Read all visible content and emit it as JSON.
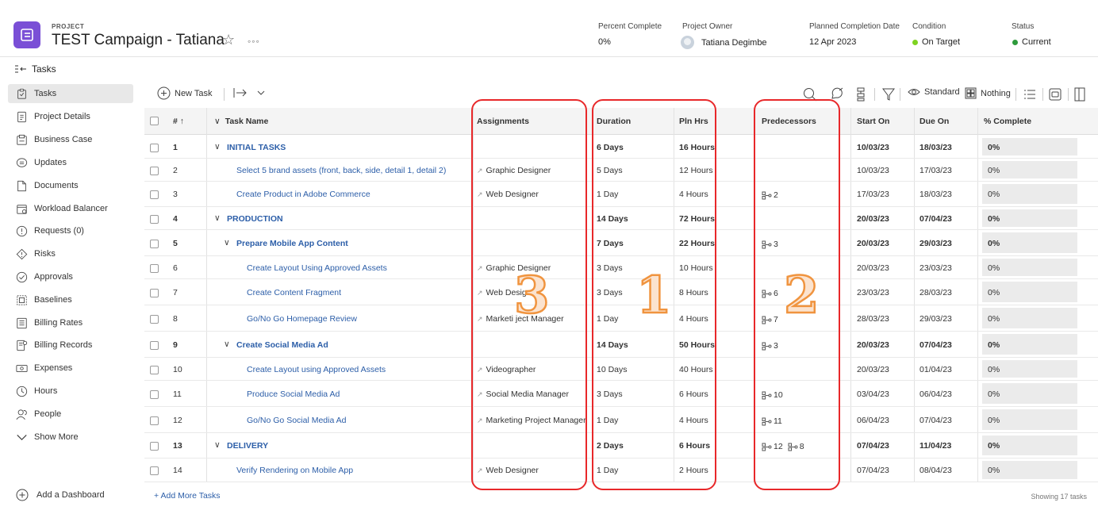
{
  "header": {
    "project_label": "PROJECT",
    "title": "TEST Campaign - Tatiana",
    "more_label": "◦◦◦",
    "stats": [
      {
        "label": "Percent Complete",
        "value": "0%"
      },
      {
        "label": "Project Owner",
        "value": "Tatiana Degimbe"
      },
      {
        "label": "Planned Completion Date",
        "value": "12 Apr 2023"
      },
      {
        "label": "Condition",
        "value": "On Target",
        "color": "#7ed321"
      },
      {
        "label": "Status",
        "value": "Current",
        "color": "#2e9b3c"
      }
    ]
  },
  "breadcrumb": {
    "label": "Tasks"
  },
  "sidebar": {
    "items": [
      {
        "label": "Tasks",
        "icon": "tasks-icon"
      },
      {
        "label": "Project Details",
        "icon": "details-icon"
      },
      {
        "label": "Business Case",
        "icon": "business-case-icon"
      },
      {
        "label": "Updates",
        "icon": "updates-icon"
      },
      {
        "label": "Documents",
        "icon": "documents-icon"
      },
      {
        "label": "Workload Balancer",
        "icon": "workload-icon"
      },
      {
        "label": "Requests (0)",
        "icon": "requests-icon"
      },
      {
        "label": "Risks",
        "icon": "risks-icon"
      },
      {
        "label": "Approvals",
        "icon": "approvals-icon"
      },
      {
        "label": "Baselines",
        "icon": "baselines-icon"
      },
      {
        "label": "Billing Rates",
        "icon": "billing-rates-icon"
      },
      {
        "label": "Billing Records",
        "icon": "billing-records-icon"
      },
      {
        "label": "Expenses",
        "icon": "expenses-icon"
      },
      {
        "label": "Hours",
        "icon": "hours-icon"
      },
      {
        "label": "People",
        "icon": "people-icon"
      },
      {
        "label": "Show More",
        "icon": "chevron-down-icon"
      }
    ],
    "add_dashboard": "Add a Dashboard"
  },
  "toolbar": {
    "new_task": "New Task",
    "view": "Standard",
    "grouping": "Nothing"
  },
  "table": {
    "headers": {
      "num": "# ↑",
      "name": "Task Name",
      "assignments": "Assignments",
      "duration": "Duration",
      "pln_hrs": "Pln Hrs",
      "predecessors": "Predecessors",
      "start": "Start On",
      "due": "Due On",
      "pct": "% Complete"
    },
    "rows": [
      {
        "num": "1",
        "name": "INITIAL TASKS",
        "level": 0,
        "parent": true,
        "assignment": "",
        "duration": "6 Days",
        "hours": "16 Hours",
        "preds": [],
        "start": "10/03/23",
        "due": "18/03/23",
        "pct": "0%"
      },
      {
        "num": "2",
        "name": "Select 5 brand assets (front, back, side, detail 1, detail 2)",
        "level": 1,
        "parent": false,
        "assignment": "Graphic Designer",
        "duration": "5 Days",
        "hours": "12 Hours",
        "preds": [],
        "start": "10/03/23",
        "due": "17/03/23",
        "pct": "0%"
      },
      {
        "num": "3",
        "name": "Create Product in Adobe Commerce",
        "level": 1,
        "parent": false,
        "assignment": "Web Designer",
        "duration": "1 Day",
        "hours": "4 Hours",
        "preds": [
          "2"
        ],
        "start": "17/03/23",
        "due": "18/03/23",
        "pct": "0%"
      },
      {
        "num": "4",
        "name": "PRODUCTION",
        "level": 0,
        "parent": true,
        "assignment": "",
        "duration": "14 Days",
        "hours": "72 Hours",
        "preds": [],
        "start": "20/03/23",
        "due": "07/04/23",
        "pct": "0%"
      },
      {
        "num": "5",
        "name": "Prepare Mobile App Content",
        "level": 1,
        "parent": true,
        "assignment": "",
        "duration": "7 Days",
        "hours": "22 Hours",
        "preds": [
          "3"
        ],
        "start": "20/03/23",
        "due": "29/03/23",
        "pct": "0%"
      },
      {
        "num": "6",
        "name": "Create Layout Using Approved Assets",
        "level": 2,
        "parent": false,
        "assignment": "Graphic Designer",
        "duration": "3 Days",
        "hours": "10 Hours",
        "preds": [],
        "start": "20/03/23",
        "due": "23/03/23",
        "pct": "0%"
      },
      {
        "num": "7",
        "name": "Create Content Fragment",
        "level": 2,
        "parent": false,
        "assignment": "Web Design",
        "duration": "3 Days",
        "hours": "8 Hours",
        "preds": [
          "6"
        ],
        "start": "23/03/23",
        "due": "28/03/23",
        "pct": "0%"
      },
      {
        "num": "8",
        "name": "Go/No Go Homepage Review",
        "level": 2,
        "parent": false,
        "assignment": "Marketi ject Manager",
        "duration": "1 Day",
        "hours": "4 Hours",
        "preds": [
          "7"
        ],
        "start": "28/03/23",
        "due": "29/03/23",
        "pct": "0%"
      },
      {
        "num": "9",
        "name": "Create Social Media Ad",
        "level": 1,
        "parent": true,
        "assignment": "",
        "duration": "14 Days",
        "hours": "50 Hours",
        "preds": [
          "3"
        ],
        "start": "20/03/23",
        "due": "07/04/23",
        "pct": "0%"
      },
      {
        "num": "10",
        "name": "Create Layout using Approved Assets",
        "level": 2,
        "parent": false,
        "assignment": "Videographer",
        "duration": "10 Days",
        "hours": "40 Hours",
        "preds": [],
        "start": "20/03/23",
        "due": "01/04/23",
        "pct": "0%"
      },
      {
        "num": "11",
        "name": "Produce Social Media Ad",
        "level": 2,
        "parent": false,
        "assignment": "Social Media Manager",
        "duration": "3 Days",
        "hours": "6 Hours",
        "preds": [
          "10"
        ],
        "start": "03/04/23",
        "due": "06/04/23",
        "pct": "0%"
      },
      {
        "num": "12",
        "name": "Go/No Go Social Media Ad",
        "level": 2,
        "parent": false,
        "assignment": "Marketing Project Manager",
        "duration": "1 Day",
        "hours": "4 Hours",
        "preds": [
          "11"
        ],
        "start": "06/04/23",
        "due": "07/04/23",
        "pct": "0%"
      },
      {
        "num": "13",
        "name": "DELIVERY",
        "level": 0,
        "parent": true,
        "assignment": "",
        "duration": "2 Days",
        "hours": "6 Hours",
        "preds": [
          "12",
          "8"
        ],
        "start": "07/04/23",
        "due": "11/04/23",
        "pct": "0%"
      },
      {
        "num": "14",
        "name": "Verify Rendering on Mobile App",
        "level": 1,
        "parent": false,
        "assignment": "Web Designer",
        "duration": "1 Day",
        "hours": "2 Hours",
        "preds": [],
        "start": "07/04/23",
        "due": "08/04/23",
        "pct": "0%"
      }
    ],
    "add_more": "+ Add More Tasks",
    "showing": "Showing 17 tasks"
  },
  "annotations": {
    "labels": [
      "3",
      "1",
      "2"
    ],
    "color": "#e8282a"
  }
}
